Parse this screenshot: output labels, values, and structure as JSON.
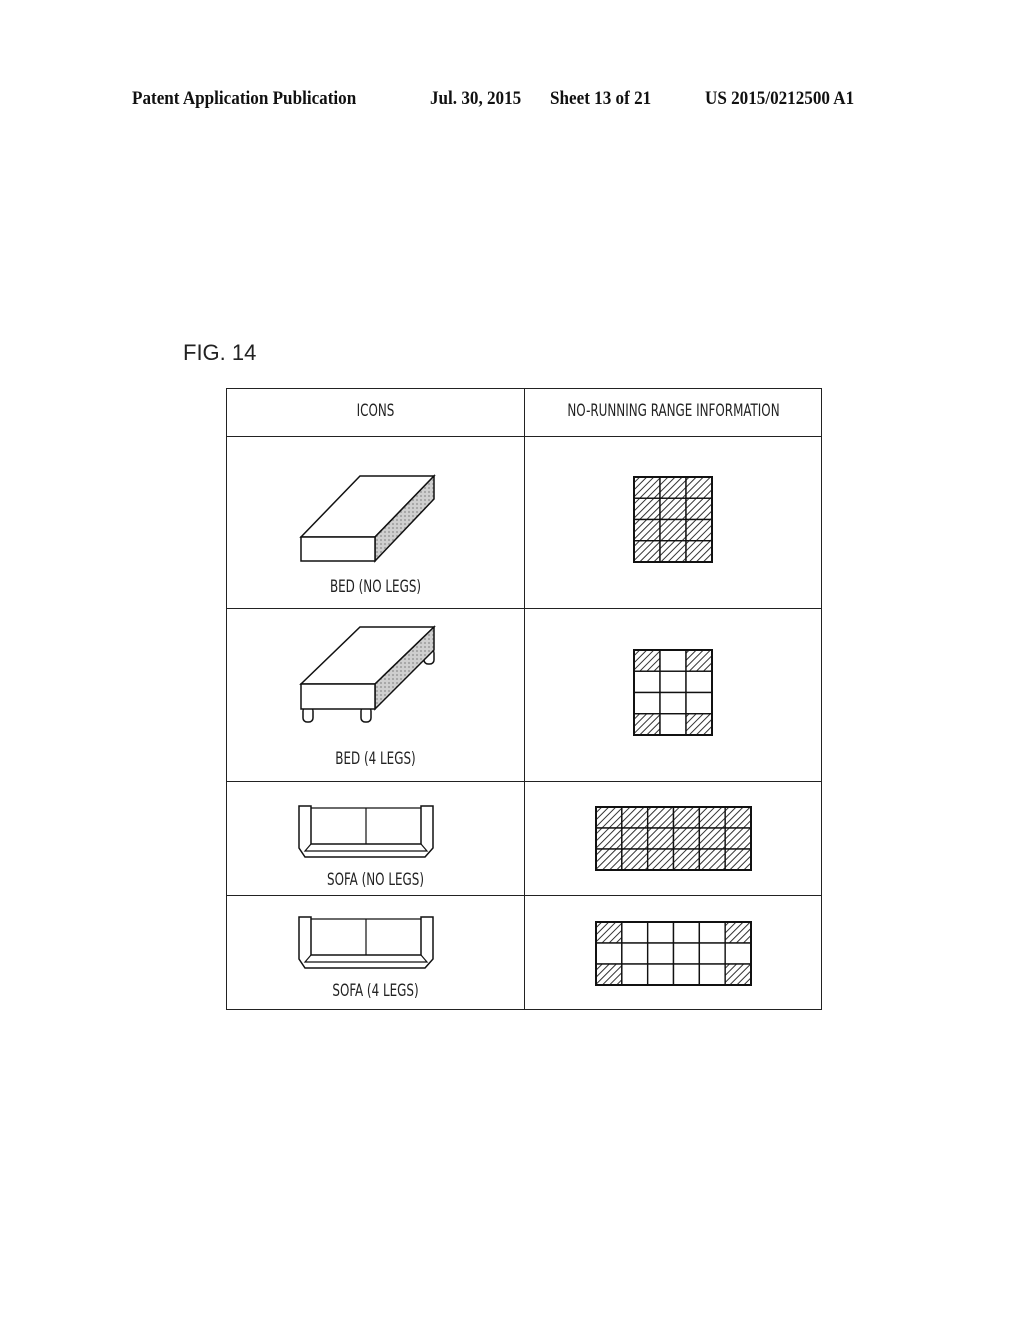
{
  "header": {
    "publication": "Patent Application Publication",
    "date": "Jul. 30, 2015",
    "sheet": "Sheet 13 of 21",
    "number": "US 2015/0212500 A1"
  },
  "figure": {
    "label": "FIG. 14"
  },
  "table": {
    "columns": [
      "ICONS",
      "NO-RUNNING RANGE INFORMATION"
    ],
    "rows": [
      {
        "icon": "bed-no-legs-icon",
        "label": "BED (NO LEGS)",
        "grid": {
          "cols": 3,
          "rows": 4,
          "hatched": [
            [
              1,
              1,
              1
            ],
            [
              1,
              1,
              1
            ],
            [
              1,
              1,
              1
            ],
            [
              1,
              1,
              1
            ]
          ]
        }
      },
      {
        "icon": "bed-4-legs-icon",
        "label": "BED (4 LEGS)",
        "grid": {
          "cols": 3,
          "rows": 4,
          "hatched": [
            [
              1,
              0,
              1
            ],
            [
              0,
              0,
              0
            ],
            [
              0,
              0,
              0
            ],
            [
              1,
              0,
              1
            ]
          ]
        }
      },
      {
        "icon": "sofa-no-legs-icon",
        "label": "SOFA (NO LEGS)",
        "grid": {
          "cols": 6,
          "rows": 3,
          "hatched": [
            [
              1,
              1,
              1,
              1,
              1,
              1
            ],
            [
              1,
              1,
              1,
              1,
              1,
              1
            ],
            [
              1,
              1,
              1,
              1,
              1,
              1
            ]
          ]
        }
      },
      {
        "icon": "sofa-4-legs-icon",
        "label": "SOFA (4 LEGS)",
        "grid": {
          "cols": 6,
          "rows": 3,
          "hatched": [
            [
              1,
              0,
              0,
              0,
              0,
              1
            ],
            [
              0,
              0,
              0,
              0,
              0,
              0
            ],
            [
              1,
              0,
              0,
              0,
              0,
              1
            ]
          ]
        }
      }
    ]
  }
}
